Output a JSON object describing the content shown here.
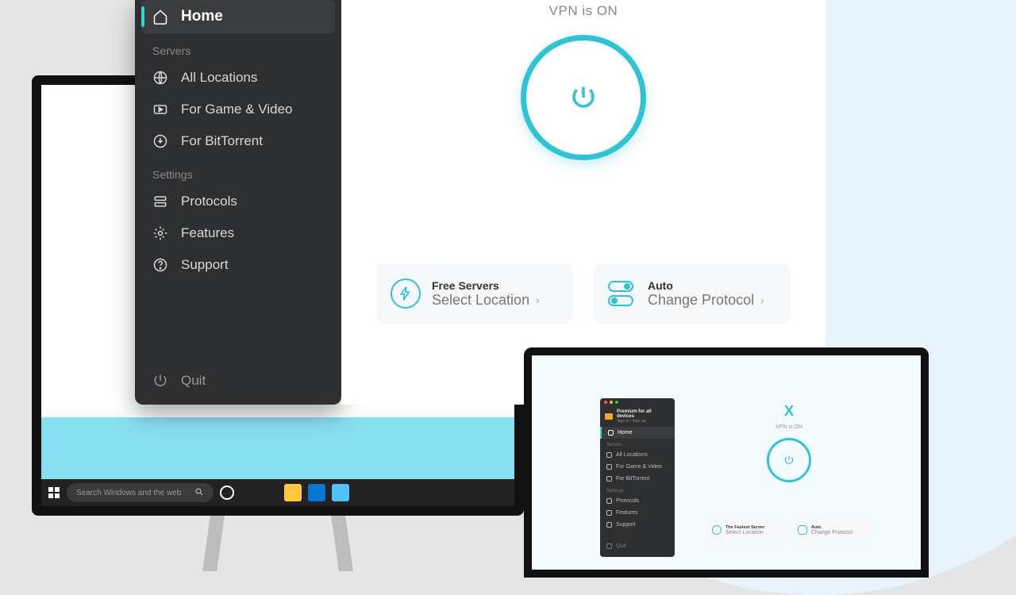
{
  "sidebar": {
    "home": "Home",
    "sections": {
      "servers": "Servers",
      "settings": "Settings"
    },
    "servers": {
      "all": "All Locations",
      "game": "For Game & Video",
      "torrent": "For BitTorrent"
    },
    "settings": {
      "protocols": "Protocols",
      "features": "Features",
      "support": "Support"
    },
    "quit": "Quit"
  },
  "main": {
    "status": "VPN is ON",
    "card1": {
      "title": "Free Servers",
      "action": "Select Location"
    },
    "card2": {
      "title": "Auto",
      "action": "Change Protocol"
    }
  },
  "taskbar": {
    "search_placeholder": "Search Windows and the web"
  },
  "laptop": {
    "premium_title": "Premium for all devices",
    "premium_sub": "Sign in / Sign up",
    "home": "Home",
    "sec_servers": "Servers",
    "all": "All Locations",
    "game": "For Game & Video",
    "torrent": "For BitTorrent",
    "sec_settings": "Settings",
    "protocols": "Protocols",
    "features": "Features",
    "support": "Support",
    "quit": "Quit",
    "logo": "X",
    "status": "VPN is ON",
    "c1t": "The Fastest Server",
    "c1a": "Select Location",
    "c2t": "Auto",
    "c2a": "Change Protocol"
  }
}
